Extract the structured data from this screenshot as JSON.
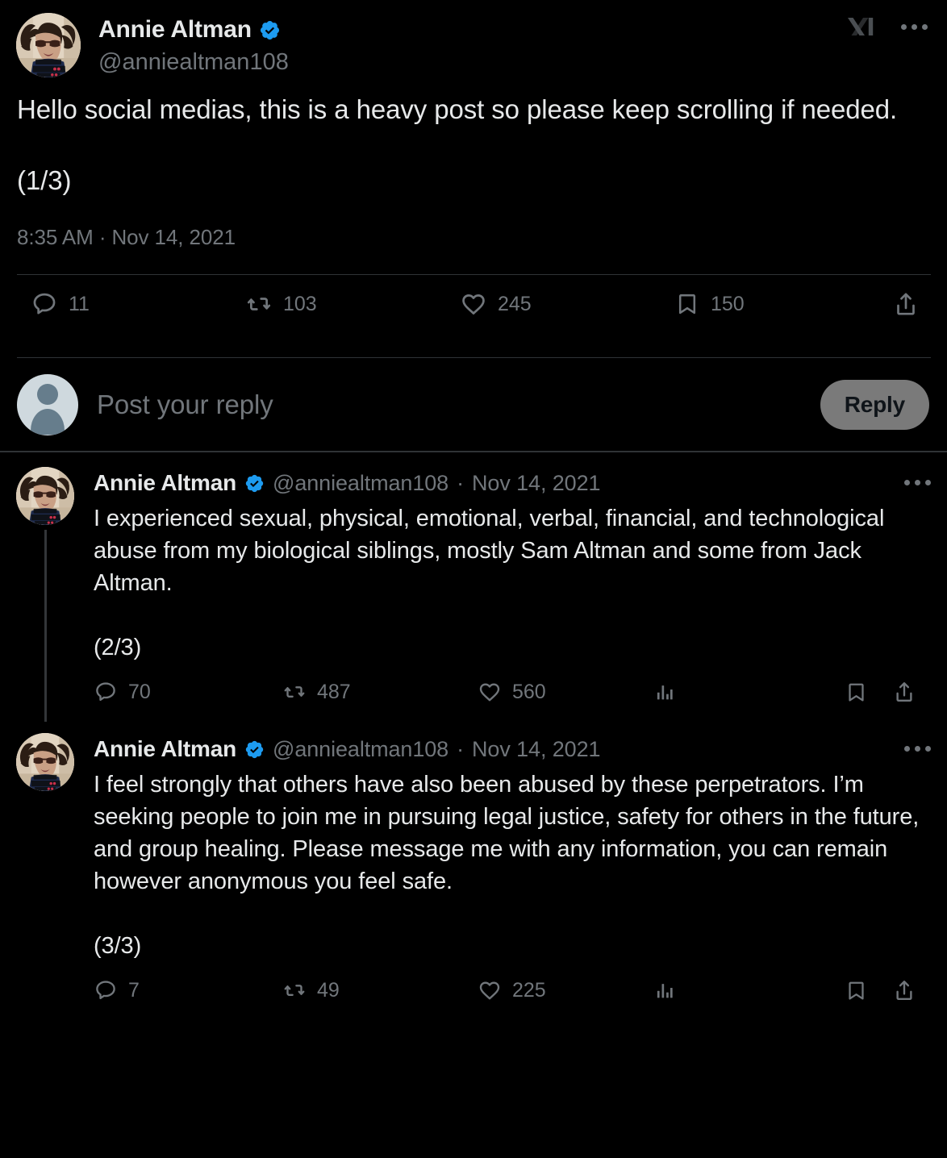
{
  "theme": {
    "background": "#000000",
    "text_primary": "#e7e9ea",
    "text_secondary": "#71767b",
    "verified_blue": "#1d9bf0",
    "divider": "#2f3336",
    "reply_button_bg": "#7a7a7a"
  },
  "main_post": {
    "display_name": "Annie Altman",
    "handle": "@anniealtman108",
    "verified_badge": "verified-badge-icon",
    "xai_logo": "xai-logo-icon",
    "more_menu": "more-options-icon",
    "body": "Hello social medias, this is a heavy post so please keep scrolling if needed.\n\n(1/3)",
    "timestamp": "8:35 AM · Nov 14, 2021",
    "actions": {
      "reply": {
        "icon": "reply-icon",
        "count": "11"
      },
      "retweet": {
        "icon": "retweet-icon",
        "count": "103"
      },
      "like": {
        "icon": "heart-icon",
        "count": "245"
      },
      "bookmark": {
        "icon": "bookmark-icon",
        "count": "150"
      },
      "share": {
        "icon": "share-icon",
        "count": ""
      }
    }
  },
  "composer": {
    "avatar": "default-avatar-icon",
    "placeholder": "Post your reply",
    "reply_label": "Reply"
  },
  "replies": [
    {
      "display_name": "Annie Altman",
      "verified_badge": "verified-badge-icon",
      "handle": "@anniealtman108",
      "separator": "·",
      "date": "Nov 14, 2021",
      "more_menu": "more-options-icon",
      "body": "I experienced sexual, physical, emotional, verbal, financial, and technological abuse from my biological siblings, mostly Sam Altman and some from Jack Altman.\n\n(2/3)",
      "actions": {
        "reply": {
          "icon": "reply-icon",
          "count": "70"
        },
        "retweet": {
          "icon": "retweet-icon",
          "count": "487"
        },
        "like": {
          "icon": "heart-icon",
          "count": "560"
        },
        "views": {
          "icon": "analytics-icon",
          "count": ""
        },
        "bookmark": {
          "icon": "bookmark-icon",
          "count": ""
        },
        "share": {
          "icon": "share-icon",
          "count": ""
        }
      }
    },
    {
      "display_name": "Annie Altman",
      "verified_badge": "verified-badge-icon",
      "handle": "@anniealtman108",
      "separator": "·",
      "date": "Nov 14, 2021",
      "more_menu": "more-options-icon",
      "body": "I feel strongly that others have also been abused by these perpetrators. I’m seeking people to join me in pursuing legal justice, safety for others in the future, and group healing. Please message me with any information, you can remain however anonymous you feel safe.\n\n(3/3)",
      "actions": {
        "reply": {
          "icon": "reply-icon",
          "count": "7"
        },
        "retweet": {
          "icon": "retweet-icon",
          "count": "49"
        },
        "like": {
          "icon": "heart-icon",
          "count": "225"
        },
        "views": {
          "icon": "analytics-icon",
          "count": ""
        },
        "bookmark": {
          "icon": "bookmark-icon",
          "count": ""
        },
        "share": {
          "icon": "share-icon",
          "count": ""
        }
      }
    }
  ]
}
